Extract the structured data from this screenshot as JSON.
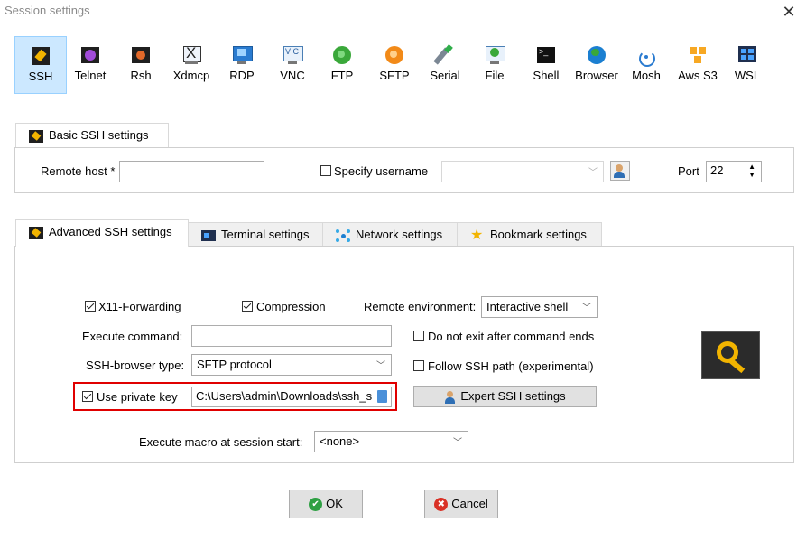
{
  "window": {
    "title": "Session settings",
    "close_symbol": "✕"
  },
  "protocols": [
    {
      "label": "SSH",
      "icon": "ssh-key-icon",
      "selected": true
    },
    {
      "label": "Telnet",
      "icon": "telnet-icon"
    },
    {
      "label": "Rsh",
      "icon": "rsh-icon"
    },
    {
      "label": "Xdmcp",
      "icon": "xdmcp-icon"
    },
    {
      "label": "RDP",
      "icon": "rdp-icon"
    },
    {
      "label": "VNC",
      "icon": "vnc-icon"
    },
    {
      "label": "FTP",
      "icon": "ftp-icon"
    },
    {
      "label": "SFTP",
      "icon": "sftp-icon"
    },
    {
      "label": "Serial",
      "icon": "serial-icon"
    },
    {
      "label": "File",
      "icon": "file-icon"
    },
    {
      "label": "Shell",
      "icon": "shell-icon"
    },
    {
      "label": "Browser",
      "icon": "browser-icon"
    },
    {
      "label": "Mosh",
      "icon": "mosh-icon"
    },
    {
      "label": "Aws S3",
      "icon": "aws-s3-icon"
    },
    {
      "label": "WSL",
      "icon": "wsl-icon"
    }
  ],
  "basic": {
    "tab_label": "Basic SSH settings",
    "remote_host_label": "Remote host *",
    "remote_host_value": "",
    "specify_username_label": "Specify username",
    "specify_username_checked": false,
    "username_value": "",
    "port_label": "Port",
    "port_value": "22"
  },
  "tabs": [
    {
      "label": "Advanced SSH settings",
      "active": true
    },
    {
      "label": "Terminal settings"
    },
    {
      "label": "Network settings"
    },
    {
      "label": "Bookmark settings"
    }
  ],
  "advanced": {
    "x11_label": "X11-Forwarding",
    "x11_checked": true,
    "compression_label": "Compression",
    "compression_checked": true,
    "remote_env_label": "Remote environment:",
    "remote_env_value": "Interactive shell",
    "execute_command_label": "Execute command:",
    "execute_command_value": "",
    "do_not_exit_label": "Do not exit after command ends",
    "do_not_exit_checked": false,
    "browser_type_label": "SSH-browser type:",
    "browser_type_value": "SFTP protocol",
    "follow_path_label": "Follow SSH path (experimental)",
    "follow_path_checked": false,
    "private_key_label": "Use private key",
    "private_key_checked": true,
    "private_key_value": "C:\\Users\\admin\\Downloads\\ssh_s",
    "expert_label": "Expert SSH settings",
    "macro_label": "Execute macro at session start:",
    "macro_value": "<none>"
  },
  "buttons": {
    "ok": "OK",
    "cancel": "Cancel"
  },
  "colors": {
    "selected_bg": "#cce8ff",
    "highlight": "#e00000",
    "ok_green": "#2ea043",
    "cancel_red": "#d93025"
  }
}
